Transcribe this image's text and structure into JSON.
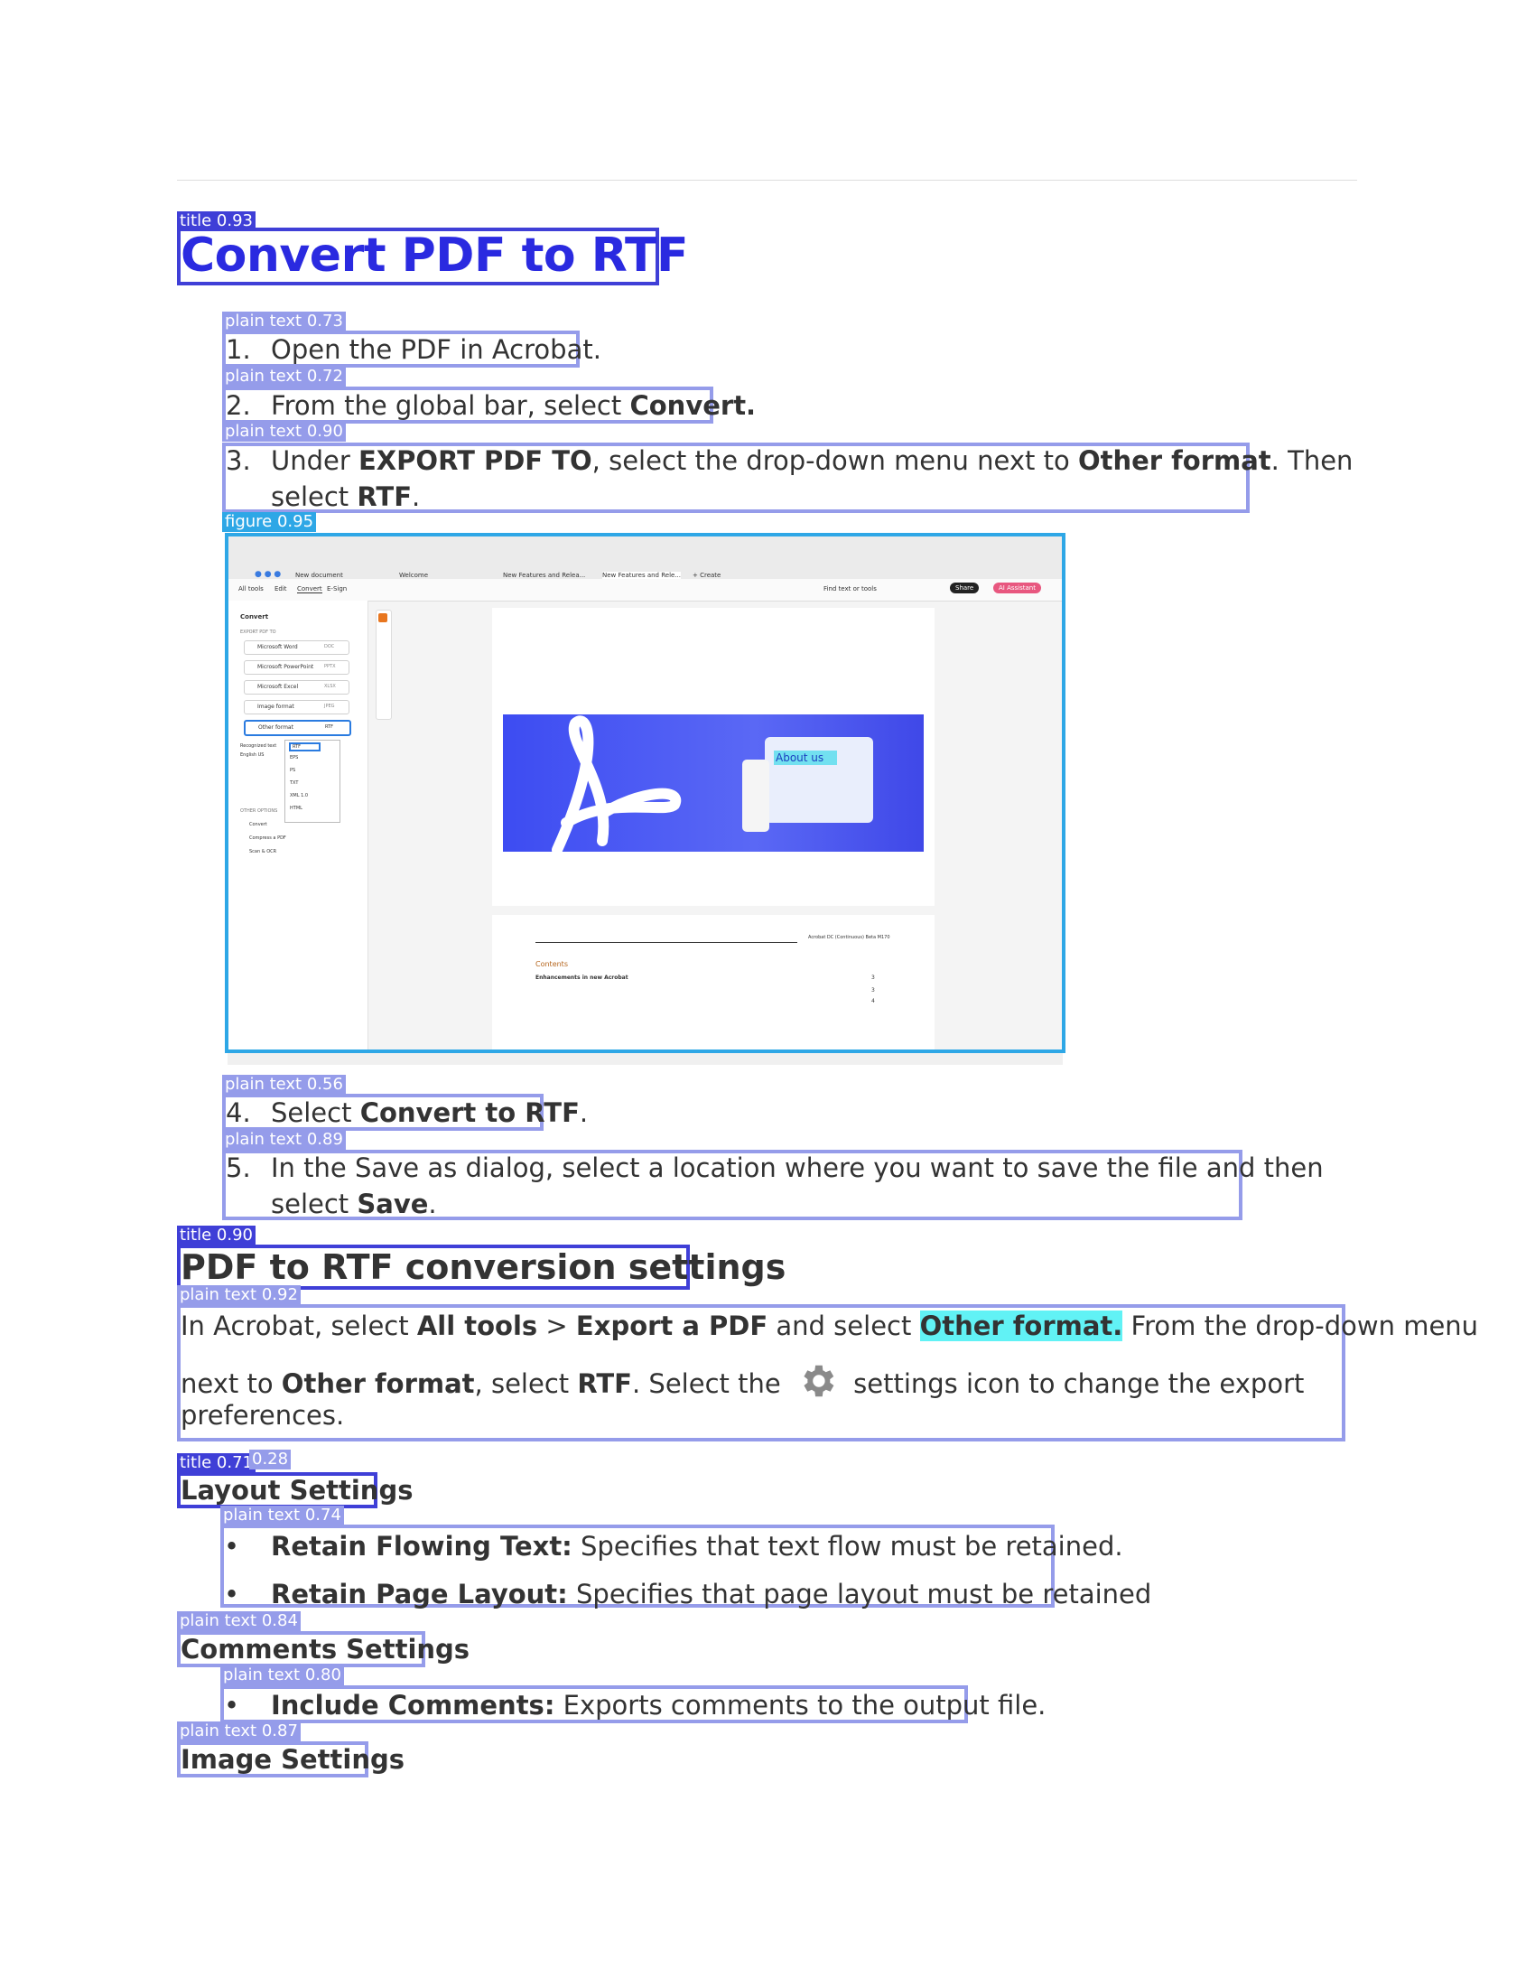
{
  "title": "Convert PDF to RTF",
  "steps": {
    "s1_num": "1.",
    "s1_text": "Open the PDF in Acrobat.",
    "s2_num": "2.",
    "s2_pre": "From the global bar, select ",
    "s2_b": "Convert.",
    "s3_num": "3.",
    "s3_pre": "Under ",
    "s3_b1": "EXPORT PDF TO",
    "s3_mid": ", select the drop-down menu next to ",
    "s3_b2": "Other format",
    "s3_post": ". Then",
    "s3_l2_pre": "select ",
    "s3_l2_b": "RTF",
    "s3_l2_post": ".",
    "s4_num": "4.",
    "s4_pre": "Select ",
    "s4_b": "Convert to RTF",
    "s4_post": ".",
    "s5_num": "5.",
    "s5_text": "In the Save as dialog, select a location where you want to save the file and then",
    "s5_l2_pre": "select ",
    "s5_l2_b": "Save",
    "s5_l2_post": "."
  },
  "section": {
    "title": "PDF to RTF conversion settings",
    "p_a": "In Acrobat, select ",
    "p_b1": "All tools",
    "p_c": " > ",
    "p_b2": "Export a PDF",
    "p_d": " and select ",
    "p_hl": "Other format.",
    "p_e": " From the drop-down menu",
    "p2_a": "next to ",
    "p2_b1": "Other format",
    "p2_c": ", select ",
    "p2_b2": "RTF",
    "p2_d": ". Select the ",
    "p2_e": " settings icon to change the export",
    "p3": "preferences."
  },
  "layout_settings": {
    "title": "Layout Settings",
    "b1": "•",
    "i1_b": "Retain Flowing Text:",
    "i1_t": " Specifies that text flow must be retained.",
    "b2": "•",
    "i2_b": "Retain Page Layout:",
    "i2_t": " Specifies that page layout must be retained"
  },
  "comments_settings": {
    "title": "Comments Settings",
    "b1": "•",
    "i1_b": "Include Comments:",
    "i1_t": " Exports comments to the output file."
  },
  "image_settings": {
    "title": "Image Settings"
  },
  "tags": {
    "t1": "title 0.93",
    "t2": "plain text 0.73",
    "t3": "plain text 0.72",
    "t4": "plain text 0.90",
    "t5": "figure 0.95",
    "t6": "plain text 0.56",
    "t7": "plain text 0.89",
    "t8": "title 0.90",
    "t9": "plain text 0.92",
    "t10": "title 0.71",
    "t10b": "0.28",
    "t11": "plain text 0.74",
    "t12": "plain text 0.84",
    "t13": "plain text 0.80",
    "t14": "plain text 0.87"
  },
  "screenshot": {
    "tab1": "New document",
    "tab2": "Welcome",
    "tab3": "New Features and Relea...",
    "tab4": "New Features and Rele...",
    "tab5": "+ Create",
    "menu1": "All tools",
    "menu2": "Edit",
    "menu3": "Convert",
    "menu4": "E-Sign",
    "find": "Find text or tools",
    "share": "Share",
    "ai": "AI Assistant",
    "panel_title": "Convert",
    "export_label": "EXPORT PDF TO",
    "opt1": "Microsoft Word",
    "opt1v": "DOC",
    "opt2": "Microsoft PowerPoint",
    "opt2v": "PPTX",
    "opt3": "Microsoft Excel",
    "opt3v": "XLSX",
    "opt4": "Image format",
    "opt4v": "JPEG",
    "opt5": "Other format",
    "opt5v": "RTF",
    "dd1": "RTF",
    "dd2": "EPS",
    "dd3": "PS",
    "dd4": "TXT",
    "dd5": "XML 1.0",
    "dd6": "HTML",
    "rec": "Recognized text",
    "lang": "English US",
    "other": "OTHER OPTIONS",
    "o1": "Convert",
    "o2": "Compress a PDF",
    "o3": "Scan & OCR",
    "about": "About us",
    "toc_header": "Acrobat DC (Continuous) Beta M170",
    "contents": "Contents",
    "toc1": "Enhancements in new Acrobat",
    "toc1p": "3",
    "toc2p": "3",
    "toc3p": "4"
  },
  "colors": {
    "title_blue": "#2a2ae0",
    "box_light": "#959cea",
    "box_dark": "#3f3fd7",
    "figure_box": "#2ea7e6",
    "highlight": "#61f2f5"
  }
}
